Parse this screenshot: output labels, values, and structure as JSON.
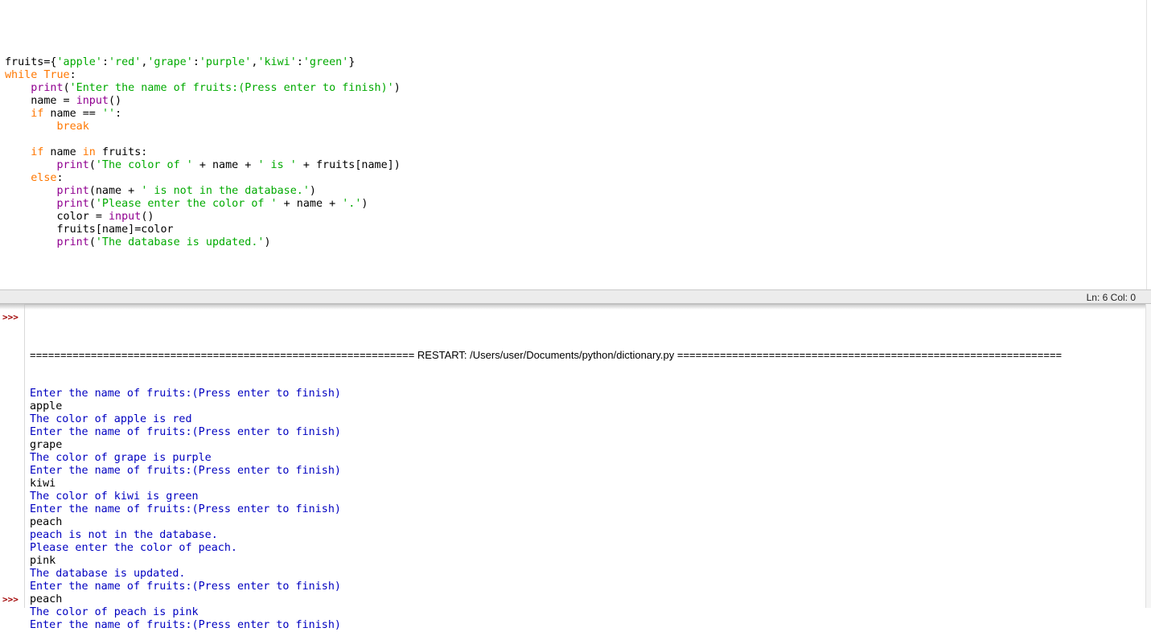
{
  "editor": {
    "lines": [
      [
        {
          "t": "fruits={",
          "c": ""
        },
        {
          "t": "'apple'",
          "c": "st"
        },
        {
          "t": ":",
          "c": ""
        },
        {
          "t": "'red'",
          "c": "st"
        },
        {
          "t": ",",
          "c": ""
        },
        {
          "t": "'grape'",
          "c": "st"
        },
        {
          "t": ":",
          "c": ""
        },
        {
          "t": "'purple'",
          "c": "st"
        },
        {
          "t": ",",
          "c": ""
        },
        {
          "t": "'kiwi'",
          "c": "st"
        },
        {
          "t": ":",
          "c": ""
        },
        {
          "t": "'green'",
          "c": "st"
        },
        {
          "t": "}",
          "c": ""
        }
      ],
      [
        {
          "t": "while",
          "c": "kw"
        },
        {
          "t": " ",
          "c": ""
        },
        {
          "t": "True",
          "c": "kw"
        },
        {
          "t": ":",
          "c": ""
        }
      ],
      [
        {
          "t": "    ",
          "c": ""
        },
        {
          "t": "print",
          "c": "bi"
        },
        {
          "t": "(",
          "c": ""
        },
        {
          "t": "'Enter the name of fruits:(Press enter to finish)'",
          "c": "st"
        },
        {
          "t": ")",
          "c": ""
        }
      ],
      [
        {
          "t": "    name = ",
          "c": ""
        },
        {
          "t": "input",
          "c": "bi"
        },
        {
          "t": "()",
          "c": ""
        }
      ],
      [
        {
          "t": "    ",
          "c": ""
        },
        {
          "t": "if",
          "c": "kw"
        },
        {
          "t": " name == ",
          "c": ""
        },
        {
          "t": "''",
          "c": "st"
        },
        {
          "t": ":",
          "c": ""
        }
      ],
      [
        {
          "t": "        ",
          "c": ""
        },
        {
          "t": "break",
          "c": "kw"
        }
      ],
      [],
      [
        {
          "t": "    ",
          "c": ""
        },
        {
          "t": "if",
          "c": "kw"
        },
        {
          "t": " name ",
          "c": ""
        },
        {
          "t": "in",
          "c": "kw"
        },
        {
          "t": " fruits:",
          "c": ""
        }
      ],
      [
        {
          "t": "        ",
          "c": ""
        },
        {
          "t": "print",
          "c": "bi"
        },
        {
          "t": "(",
          "c": ""
        },
        {
          "t": "'The color of '",
          "c": "st"
        },
        {
          "t": " + name + ",
          "c": ""
        },
        {
          "t": "' is '",
          "c": "st"
        },
        {
          "t": " + fruits[name])",
          "c": ""
        }
      ],
      [
        {
          "t": "    ",
          "c": ""
        },
        {
          "t": "else",
          "c": "kw"
        },
        {
          "t": ":",
          "c": ""
        }
      ],
      [
        {
          "t": "        ",
          "c": ""
        },
        {
          "t": "print",
          "c": "bi"
        },
        {
          "t": "(name + ",
          "c": ""
        },
        {
          "t": "' is not in the database.'",
          "c": "st"
        },
        {
          "t": ")",
          "c": ""
        }
      ],
      [
        {
          "t": "        ",
          "c": ""
        },
        {
          "t": "print",
          "c": "bi"
        },
        {
          "t": "(",
          "c": ""
        },
        {
          "t": "'Please enter the color of '",
          "c": "st"
        },
        {
          "t": " + name + ",
          "c": ""
        },
        {
          "t": "'.'",
          "c": "st"
        },
        {
          "t": ")",
          "c": ""
        }
      ],
      [
        {
          "t": "        color = ",
          "c": ""
        },
        {
          "t": "input",
          "c": "bi"
        },
        {
          "t": "()",
          "c": ""
        }
      ],
      [
        {
          "t": "        fruits[name]=color",
          "c": ""
        }
      ],
      [
        {
          "t": "        ",
          "c": ""
        },
        {
          "t": "print",
          "c": "bi"
        },
        {
          "t": "(",
          "c": ""
        },
        {
          "t": "'The database is updated.'",
          "c": "st"
        },
        {
          "t": ")",
          "c": ""
        }
      ]
    ]
  },
  "status": {
    "position": "Ln: 6  Col: 0"
  },
  "shell": {
    "prompt": ">>>",
    "restart": "=============================================================== RESTART: /Users/user/Documents/python/dictionary.py ===============================================================",
    "output": [
      {
        "t": "Enter the name of fruits:(Press enter to finish)",
        "k": "sys"
      },
      {
        "t": "apple",
        "k": "usr"
      },
      {
        "t": "The color of apple is red",
        "k": "sys"
      },
      {
        "t": "Enter the name of fruits:(Press enter to finish)",
        "k": "sys"
      },
      {
        "t": "grape",
        "k": "usr"
      },
      {
        "t": "The color of grape is purple",
        "k": "sys"
      },
      {
        "t": "Enter the name of fruits:(Press enter to finish)",
        "k": "sys"
      },
      {
        "t": "kiwi",
        "k": "usr"
      },
      {
        "t": "The color of kiwi is green",
        "k": "sys"
      },
      {
        "t": "Enter the name of fruits:(Press enter to finish)",
        "k": "sys"
      },
      {
        "t": "peach",
        "k": "usr"
      },
      {
        "t": "peach is not in the database.",
        "k": "sys"
      },
      {
        "t": "Please enter the color of peach.",
        "k": "sys"
      },
      {
        "t": "pink",
        "k": "usr"
      },
      {
        "t": "The database is updated.",
        "k": "sys"
      },
      {
        "t": "Enter the name of fruits:(Press enter to finish)",
        "k": "sys"
      },
      {
        "t": "peach",
        "k": "usr"
      },
      {
        "t": "The color of peach is pink",
        "k": "sys"
      },
      {
        "t": "Enter the name of fruits:(Press enter to finish)",
        "k": "sys"
      }
    ]
  },
  "colors": {
    "keyword": "#ff7700",
    "builtin": "#900090",
    "string": "#00aa00",
    "stdout": "#0000c0",
    "stdin": "#000000",
    "prompt": "#a00000"
  }
}
